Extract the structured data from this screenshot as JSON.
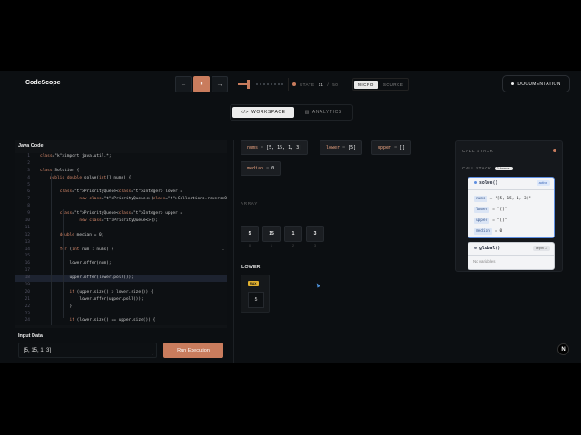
{
  "brand": "CodeScope",
  "player": {
    "prev": "←",
    "pause": "⏸",
    "next": "→",
    "progress": 0.22
  },
  "state": {
    "label": "STATE",
    "current": "11",
    "sep": "/",
    "total": "50"
  },
  "mode": {
    "micro": "MICRO",
    "source": "SOURCE"
  },
  "docs": "DOCUMENTATION",
  "tabs": {
    "workspace": "WORKSPACE",
    "analytics": "ANALYTICS"
  },
  "editor": {
    "title": "Java Code",
    "lines": [
      {
        "n": "1",
        "t": "import java.util.*;"
      },
      {
        "n": "2",
        "t": ""
      },
      {
        "n": "3",
        "t": "class Solution {"
      },
      {
        "n": "4",
        "t": "    public double solve(int[] nums) {"
      },
      {
        "n": "5",
        "t": ""
      },
      {
        "n": "6",
        "t": "        PriorityQueue<Integer> lower ="
      },
      {
        "n": "7",
        "t": "                new PriorityQueue<>(Collections.reverseOrder());"
      },
      {
        "n": "8",
        "t": ""
      },
      {
        "n": "9",
        "t": "        PriorityQueue<Integer> upper ="
      },
      {
        "n": "10",
        "t": "                new PriorityQueue<>();"
      },
      {
        "n": "11",
        "t": ""
      },
      {
        "n": "12",
        "t": "        double median = 0;"
      },
      {
        "n": "13",
        "t": ""
      },
      {
        "n": "14",
        "t": "        for (int num : nums) {"
      },
      {
        "n": "15",
        "t": ""
      },
      {
        "n": "16",
        "t": "            lower.offer(num);"
      },
      {
        "n": "17",
        "t": ""
      },
      {
        "n": "18",
        "t": "            upper.offer(lower.poll());"
      },
      {
        "n": "19",
        "t": ""
      },
      {
        "n": "20",
        "t": "            if (upper.size() > lower.size()) {"
      },
      {
        "n": "21",
        "t": "                lower.offer(upper.poll());"
      },
      {
        "n": "22",
        "t": "            }"
      },
      {
        "n": "23",
        "t": ""
      },
      {
        "n": "24",
        "t": "            if (lower.size() == upper.size()) {"
      }
    ],
    "fold_marker": "…"
  },
  "input": {
    "label": "Input Data",
    "value": "[5, 15, 1, 3]",
    "run": "Run Execution"
  },
  "vars": [
    {
      "name": "nums",
      "value": "[5, 15, 1, 3]"
    },
    {
      "name": "lower",
      "value": "[5]"
    },
    {
      "name": "upper",
      "value": "[]"
    },
    {
      "name": "median",
      "value": "0"
    }
  ],
  "array": {
    "label": "ARRAY",
    "values": [
      "5",
      "15",
      "1",
      "3"
    ],
    "indices": [
      "0",
      "1",
      "2",
      "3"
    ]
  },
  "lower": {
    "title": "LOWER",
    "badge": "MAX",
    "value": "5"
  },
  "callstack": {
    "title": "CALL STACK",
    "sub": "CALL STACK",
    "frames_badge": "2 frames",
    "active": {
      "fn": "solve()",
      "tag": "active",
      "vars": [
        {
          "n": "nums",
          "v": "\"[5, 15, 1, 3]\""
        },
        {
          "n": "lower",
          "v": "\"[]\""
        },
        {
          "n": "upper",
          "v": "\"[]\""
        },
        {
          "n": "median",
          "v": "0"
        }
      ]
    },
    "global": {
      "fn": "global()",
      "tag": "depth -1",
      "empty": "No variables"
    }
  },
  "logo": "N"
}
